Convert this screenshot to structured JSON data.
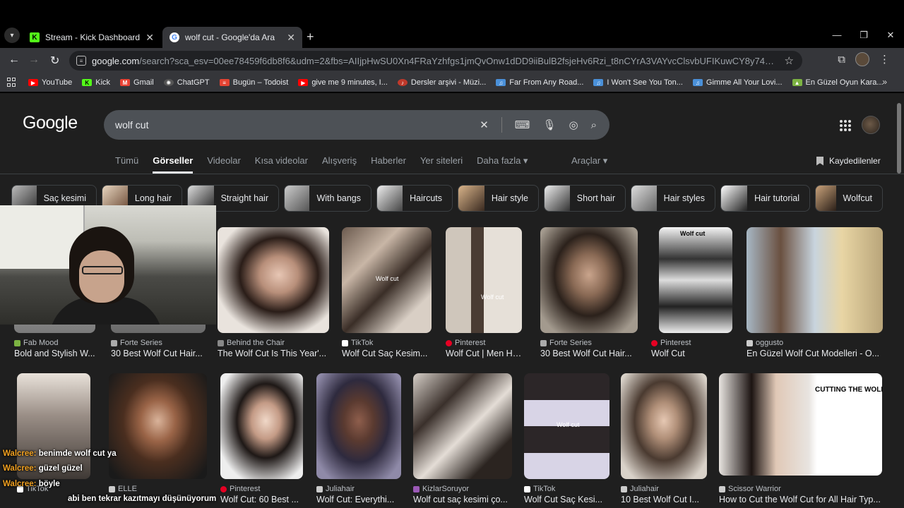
{
  "tabs": [
    {
      "title": "Stream - Kick Dashboard",
      "favicon": "kick-icon",
      "active": false
    },
    {
      "title": "wolf cut - Google'da Ara",
      "favicon": "google-icon",
      "active": true
    }
  ],
  "toolbar": {
    "url_host": "google.com",
    "url_path": "/search?sca_esv=00ee78459f6db8f6&udm=2&fbs=AIIjpHwSU0Xn4FRaYzhfgs1jmQvOnw1dDD9iiBulB2fsjeHv6Rzi_t8nCYrA3VAYvcClsvbUFIKuwCY8y74ekU_TF8DEwKt3ggvlO-d..."
  },
  "bookmarks": [
    {
      "label": "YouTube",
      "color": "#ff0000"
    },
    {
      "label": "Kick",
      "color": "#53fc18"
    },
    {
      "label": "Gmail",
      "color": "#ea4335"
    },
    {
      "label": "ChatGPT",
      "color": "#cccccc"
    },
    {
      "label": "Bugün – Todoist",
      "color": "#e44332"
    },
    {
      "label": "give me 9 minutes, I...",
      "color": "#ff0000"
    },
    {
      "label": "Dersler arşivi - Müzi...",
      "color": "#c0392b"
    },
    {
      "label": "Far From Any Road...",
      "color": "#4a90d9"
    },
    {
      "label": "I Won't See You Ton...",
      "color": "#4a90d9"
    },
    {
      "label": "Gimme All Your Lovi...",
      "color": "#4a90d9"
    },
    {
      "label": "En Güzel Oyun Kara...",
      "color": "#7cb342"
    }
  ],
  "search": {
    "logo": "Google",
    "query": "wolf cut"
  },
  "nav_tabs": [
    "Tümü",
    "Görseller",
    "Videolar",
    "Kısa videolar",
    "Alışveriş",
    "Haberler",
    "Yer siteleri",
    "Daha fazla ▾"
  ],
  "tools_label": "Araçlar ▾",
  "saved_label": "Kaydedilenler",
  "chips": [
    "Saç kesimi",
    "Long hair",
    "Straight hair",
    "With bangs",
    "Haircuts",
    "Hair style",
    "Short hair",
    "Hair styles",
    "Hair tutorial",
    "Wolfcut"
  ],
  "results_row1": [
    {
      "source": "Fab Mood",
      "title": "Bold and Stylish W...",
      "color": "#7cb342"
    },
    {
      "source": "Forte Series",
      "title": "30 Best Wolf Cut Hair...",
      "color": "#aaaaaa"
    },
    {
      "source": "Behind the Chair",
      "title": "The Wolf Cut Is This Year'...",
      "color": "#888888"
    },
    {
      "source": "TikTok",
      "title": "Wolf Cut Saç Kesim...",
      "color": "#ffffff"
    },
    {
      "source": "Pinterest",
      "title": "Wolf Cut | Men Hai...",
      "color": "#e60023"
    },
    {
      "source": "Forte Series",
      "title": "30 Best Wolf Cut Hair...",
      "color": "#aaaaaa"
    },
    {
      "source": "Pinterest",
      "title": "Wolf Cut",
      "color": "#e60023"
    },
    {
      "source": "oggusto",
      "title": "En Güzel Wolf Cut Modelleri - O...",
      "color": "#cccccc"
    }
  ],
  "results_row2": [
    {
      "source": "TikTok",
      "title": "",
      "color": "#ffffff"
    },
    {
      "source": "ELLE",
      "title": "",
      "color": "#cccccc"
    },
    {
      "source": "Pinterest",
      "title": "Wolf Cut: 60 Best ...",
      "color": "#e60023"
    },
    {
      "source": "Juliahair",
      "title": "Wolf Cut: Everythi...",
      "color": "#cccccc"
    },
    {
      "source": "KizlarSoruyor",
      "title": "Wolf cut saç kesimi ço...",
      "color": "#9b59b6"
    },
    {
      "source": "TikTok",
      "title": "Wolf Cut Saç Kesi...",
      "color": "#ffffff"
    },
    {
      "source": "Juliahair",
      "title": "10 Best Wolf Cut I...",
      "color": "#cccccc"
    },
    {
      "source": "Scissor Warrior",
      "title": "How to Cut the Wolf Cut for All Hair Typ...",
      "color": "#cccccc"
    }
  ],
  "image_text": {
    "wolf_cut_caption": "Wolf cut",
    "cutting_caption": "CUTTING THE WOLF CU"
  },
  "chat": [
    {
      "user": "Walcree:",
      "message": "benimde wolf cut ya"
    },
    {
      "user": "Walcree:",
      "message": "güzel güzel"
    },
    {
      "user": "Walcree:",
      "message": "böyle"
    },
    {
      "user": "",
      "message": "abi ben tekrar kazıtmayı düşünüyorum"
    }
  ]
}
